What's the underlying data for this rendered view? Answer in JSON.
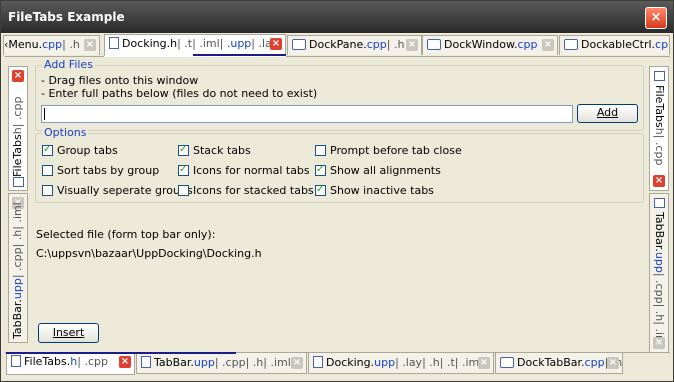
{
  "window": {
    "title": "FileTabs Example",
    "close_glyph": "×"
  },
  "top_tabs": [
    {
      "p1": "‹Menu.",
      "p2": "cpp",
      "p3": "| .h",
      "close": "×"
    },
    {
      "p1": "Docking.h",
      "p2": "| .t| .iml| ",
      "p3": ".upp",
      "p4": "| .lay",
      "close": "×"
    },
    {
      "p1": "DockPane.",
      "p2": "cpp",
      "p3": "| .h",
      "close": "×"
    },
    {
      "p1": "DockWindow.",
      "p2": "cpp",
      "close": "×"
    },
    {
      "p1": "DockableCtrl.",
      "p2": "cpp"
    }
  ],
  "left_tabs": [
    {
      "p1": "FileTabs",
      "p2": "h| .cpp",
      "close": "×"
    },
    {
      "p1": "TabBar.",
      "p2": "upp",
      "p3": "| .cpp| .h| .iml",
      "close": "×"
    }
  ],
  "right_tabs": [
    {
      "p1": "FileTabs",
      "p2": "h| .cpp",
      "close": "×"
    },
    {
      "p1": "TabBar.",
      "p2": "upp",
      "p3": "| .cpp| .h| .iml",
      "close": "×"
    }
  ],
  "add_files": {
    "label": "Add Files",
    "line1": "- Drag files onto this window",
    "line2": "- Enter full paths below (files do not need to exist)",
    "path_value": "",
    "add_button": "Add"
  },
  "options": {
    "label": "Options",
    "group_tabs": {
      "label": "Group tabs",
      "checked": true
    },
    "sort_tabs": {
      "label": "Sort tabs by group",
      "checked": false
    },
    "visually_separate": {
      "label": "Visually seperate groups",
      "checked": false
    },
    "stack_tabs": {
      "label": "Stack tabs",
      "checked": true
    },
    "icons_normal": {
      "label": "Icons for normal tabs",
      "checked": true
    },
    "icons_stacked": {
      "label": "Icons for stacked tabs",
      "checked": false
    },
    "prompt_close": {
      "label": "Prompt before tab close",
      "checked": false
    },
    "show_alignments": {
      "label": "Show all alignments",
      "checked": true
    },
    "show_inactive": {
      "label": "Show inactive tabs",
      "checked": true
    }
  },
  "selected_file": {
    "label": "Selected file (form top bar only):",
    "path": "C:\\uppsvn\\bazaar\\UppDocking\\Docking.h"
  },
  "insert_button": "Insert",
  "bottom_tabs": [
    {
      "p1": "FileTabs.",
      "p2": "h",
      "p3": "| .cpp",
      "close": "×"
    },
    {
      "p1": "TabBar.",
      "p2": "upp",
      "p3": "| .cpp| .h| .iml",
      "close": "×"
    },
    {
      "p1": "Docking.",
      "p2": "upp",
      "p3": "| .lay| .h| .t| .iml",
      "close": "×"
    },
    {
      "p1": "DockTabBar.",
      "p2": "cpp",
      "p3": "| .h",
      "close": "×"
    }
  ],
  "colors": {
    "accent": "#1640c8",
    "close_red": "#e04030",
    "check_green": "#21a121"
  }
}
